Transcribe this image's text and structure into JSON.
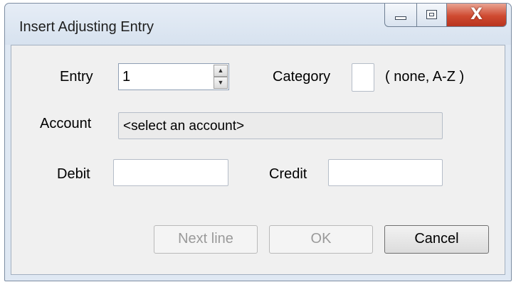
{
  "window": {
    "title": "Insert Adjusting Entry"
  },
  "caption_buttons": {
    "minimize_icon": "minimize-icon",
    "maximize_icon": "maximize-icon",
    "close_icon": "close-icon",
    "close_glyph": "X"
  },
  "form": {
    "entry_label": "Entry",
    "entry_value": "1",
    "category_label": "Category",
    "category_value": "",
    "category_hint": "( none, A-Z )",
    "account_label": "Account",
    "account_value": "<select an account>",
    "debit_label": "Debit",
    "debit_value": "",
    "credit_label": "Credit",
    "credit_value": ""
  },
  "buttons": {
    "next_line": "Next line",
    "ok": "OK",
    "cancel": "Cancel"
  },
  "colors": {
    "window_frame": "#dfe8f3",
    "client_background": "#f0f0f0",
    "close_button": "#cf4a31",
    "disabled_text": "#9a9a9a"
  }
}
